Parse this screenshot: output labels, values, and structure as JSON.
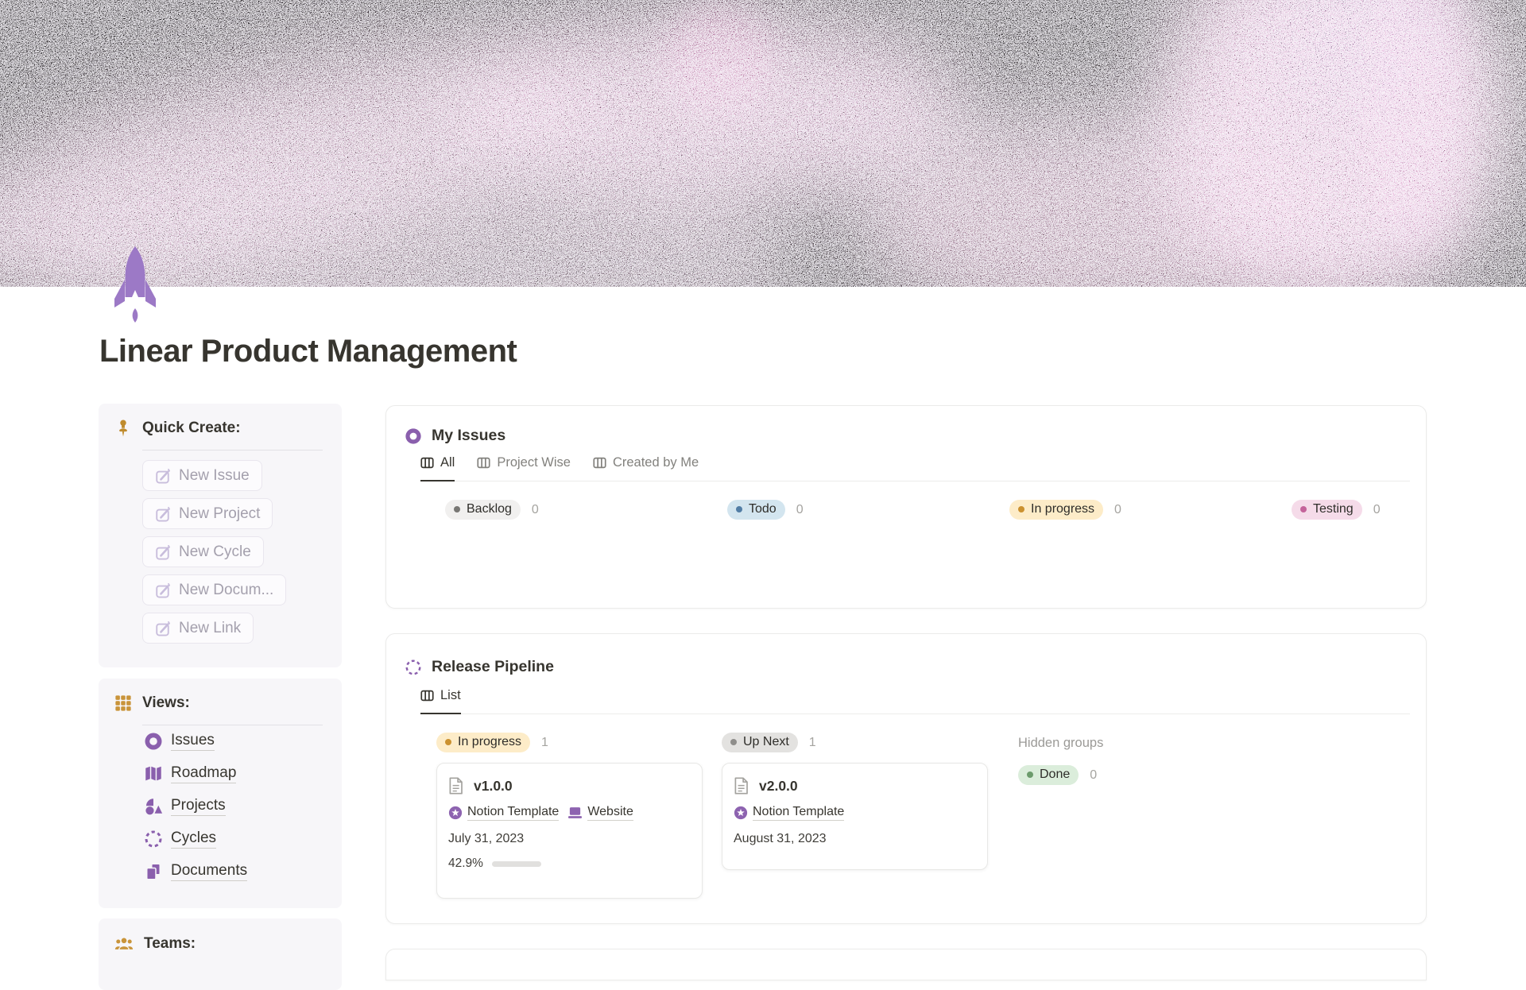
{
  "page": {
    "title": "Linear Product Management",
    "icon": "rocket"
  },
  "sidebar": {
    "quick_create": {
      "heading": "Quick Create:",
      "buttons": [
        {
          "label": "New Issue"
        },
        {
          "label": "New Project"
        },
        {
          "label": "New Cycle"
        },
        {
          "label": "New Docum..."
        },
        {
          "label": "New Link"
        }
      ]
    },
    "views": {
      "heading": "Views:",
      "items": [
        {
          "label": "Issues",
          "icon": "target-icon"
        },
        {
          "label": "Roadmap",
          "icon": "map-icon"
        },
        {
          "label": "Projects",
          "icon": "shapes-icon"
        },
        {
          "label": "Cycles",
          "icon": "dashed-circle-icon"
        },
        {
          "label": "Documents",
          "icon": "pages-icon"
        }
      ]
    },
    "teams": {
      "heading": "Teams:"
    }
  },
  "my_issues": {
    "title": "My Issues",
    "active_tab": "All",
    "tabs": [
      {
        "label": "All"
      },
      {
        "label": "Project Wise"
      },
      {
        "label": "Created by Me"
      }
    ],
    "groups": [
      {
        "label": "Backlog",
        "count": "0",
        "pill_bg": "#f1f0ef",
        "dot_color": "#787774"
      },
      {
        "label": "Todo",
        "count": "0",
        "pill_bg": "#d3e5ef",
        "dot_color": "#527da5"
      },
      {
        "label": "In progress",
        "count": "0",
        "pill_bg": "#fdecc8",
        "dot_color": "#cb912f"
      },
      {
        "label": "Testing",
        "count": "0",
        "pill_bg": "#f5dbe9",
        "dot_color": "#c4639a"
      }
    ]
  },
  "release_pipeline": {
    "title": "Release Pipeline",
    "active_tab": "List",
    "tabs": [
      {
        "label": "List"
      }
    ],
    "groups": [
      {
        "label": "In progress",
        "count": "1",
        "pill_bg": "#fdecc8",
        "dot_color": "#cb912f",
        "cards": [
          {
            "title": "v1.0.0",
            "tags": [
              {
                "label": "Notion Template",
                "icon": "star-badge-icon"
              },
              {
                "label": "Website",
                "icon": "laptop-icon"
              }
            ],
            "date": "July 31, 2023",
            "progress_label": "42.9%",
            "progress_value": 42.9
          }
        ]
      },
      {
        "label": "Up Next",
        "count": "1",
        "pill_bg": "#e3e2e0",
        "dot_color": "#8f8e8b",
        "cards": [
          {
            "title": "v2.0.0",
            "tags": [
              {
                "label": "Notion Template",
                "icon": "star-badge-icon"
              }
            ],
            "date": "August 31, 2023"
          }
        ]
      }
    ],
    "hidden": {
      "label": "Hidden groups",
      "groups": [
        {
          "label": "Done",
          "count": "0",
          "pill_bg": "#dbeddb",
          "dot_color": "#6c9b6c"
        }
      ]
    }
  },
  "colors": {
    "accent_purple": "#8a5fad",
    "accent_gold": "#c0912f",
    "progress_fill": "#6f9583",
    "banner_bg": "#070406"
  }
}
